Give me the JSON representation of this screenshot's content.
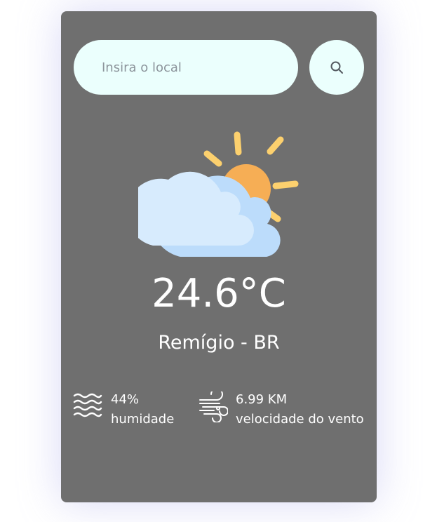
{
  "search": {
    "placeholder": "Insira o local",
    "value": "",
    "button_icon": "search-icon"
  },
  "weather": {
    "condition_icon": "partly-cloudy-day-icon",
    "temperature": "24.6°C",
    "location": "Remígio - BR"
  },
  "stats": {
    "humidity": {
      "icon": "waves-icon",
      "value": "44%",
      "label": "humidade"
    },
    "wind": {
      "icon": "wind-icon",
      "value": "6.99 KM",
      "label": "velocidade do vento"
    }
  },
  "colors": {
    "card_background": "#6f6f6f",
    "input_background": "#ebfffd",
    "sun": "#f6ae55",
    "sun_rays": "#fcd06e",
    "cloud": "#d7ebfd",
    "cloud_shade": "#bcdcfb",
    "text": "#ffffff"
  }
}
